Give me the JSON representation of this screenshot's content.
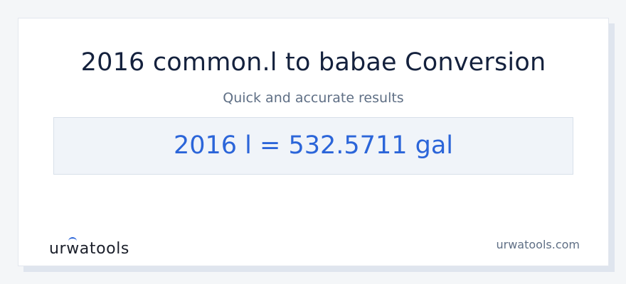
{
  "card": {
    "title": "2016 common.l to babae Conversion",
    "subtitle": "Quick and accurate results",
    "result": "2016 l = 532.5711 gal"
  },
  "footer": {
    "logo_text_part1": "ur",
    "logo_text_mark": "w",
    "logo_text_part2": "atools",
    "site": "urwatools.com"
  },
  "colors": {
    "accent": "#2b65d9",
    "title": "#14213d",
    "muted": "#5f6f85"
  }
}
